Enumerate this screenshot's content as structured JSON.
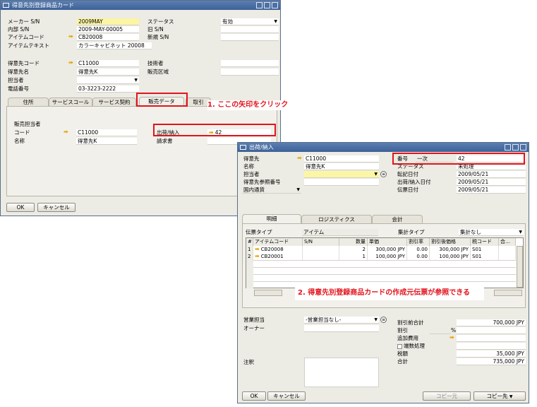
{
  "w1": {
    "title": "得意先別登録商品カード",
    "fields": {
      "maker_sn_label": "メーカー S/N",
      "maker_sn_value": "2009MAY",
      "status_label": "ステータス",
      "status_value": "有効",
      "internal_sn_label": "内部 S/N",
      "internal_sn_value": "2009-MAY-00005",
      "old_sn_label": "旧 S/N",
      "old_sn_value": "",
      "item_code_label": "アイテムコード",
      "item_code_value": "CB20008",
      "new_sn_label": "新規 S/N",
      "new_sn_value": "",
      "item_text_label": "アイテムテキスト",
      "item_text_value": "カラーキャビネット 20008",
      "cust_code_label": "得意先コード",
      "cust_code_value": "C11000",
      "tech_label": "技術者",
      "tech_value": "",
      "cust_name_label": "得意先名",
      "cust_name_value": "得意先K",
      "sales_area_label": "販売区域",
      "sales_area_value": "",
      "contact_label": "担当者",
      "contact_value": "",
      "phone_label": "電話番号",
      "phone_value": "03-3223-2222"
    },
    "tabs": [
      "住所",
      "サービスコール",
      "サービス契約",
      "販売データ",
      "取引"
    ],
    "panel": {
      "group_label": "販売担当者",
      "code_label": "コード",
      "code_value": "C11000",
      "name_label": "名称",
      "name_value": "得意先K",
      "delivery_label": "出荷/納入",
      "delivery_value": "42",
      "invoice_label": "請求書",
      "invoice_value": ""
    },
    "buttons": {
      "ok": "OK",
      "cancel": "キャンセル"
    }
  },
  "callout1": "1. ここの矢印をクリック",
  "callout2": "2. 得意先別登録商品カードの作成元伝票が参照できる",
  "w2": {
    "title": "出荷/納入",
    "left": {
      "customer_label": "得意先",
      "customer_value": "C11000",
      "name_label": "名称",
      "name_value": "得意先K",
      "contact_label": "担当者",
      "contact_value": "",
      "ref_label": "得意先参照番号",
      "ref_value": "",
      "currency_value": "国内通貨"
    },
    "right": {
      "number_label": "番号",
      "number_series": "一次",
      "number_value": "42",
      "status_label": "ステータス",
      "status_value": "未処理",
      "posting_label": "転記日付",
      "posting_value": "2009/05/21",
      "delivery_date_label": "出荷/納入日付",
      "delivery_date_value": "2009/05/21",
      "doc_date_label": "伝票日付",
      "doc_date_value": "2009/05/21"
    },
    "tabs": [
      "明細",
      "ロジスティクス",
      "会計"
    ],
    "doc_type_label": "伝票タイプ",
    "doc_type_value": "アイテム",
    "summary_type_label": "集計タイプ",
    "summary_type_value": "集計なし",
    "table": {
      "headers": [
        "#",
        "アイテムコード",
        "S/N",
        "数量",
        "単価",
        "割引率",
        "割引後価格",
        "税コード",
        "合…"
      ],
      "rows": [
        [
          "1",
          "CB20008",
          "",
          "2",
          "300,000 JPY",
          "0.00",
          "300,000 JPY",
          "S01",
          ""
        ],
        [
          "2",
          "CB20001",
          "",
          "1",
          "100,000 JPY",
          "0.00",
          "100,000 JPY",
          "S01",
          ""
        ]
      ]
    },
    "bottom_left": {
      "sales_emp_label": "営業担当",
      "sales_emp_value": "-営業担当なし-",
      "owner_label": "オーナー",
      "owner_value": "",
      "remarks_label": "注釈"
    },
    "bottom_right": {
      "subtotal_label": "割引前合計",
      "subtotal_value": "700,000 JPY",
      "discount_label": "割引",
      "discount_pct": "%",
      "freight_label": "追加費用",
      "rounding_label": "端数処理",
      "tax_label": "税額",
      "tax_value": "35,000 JPY",
      "total_label": "合計",
      "total_value": "735,000 JPY"
    },
    "buttons": {
      "ok": "OK",
      "cancel": "キャンセル",
      "copy_from": "コピー元",
      "copy_to": "コピー先"
    }
  }
}
